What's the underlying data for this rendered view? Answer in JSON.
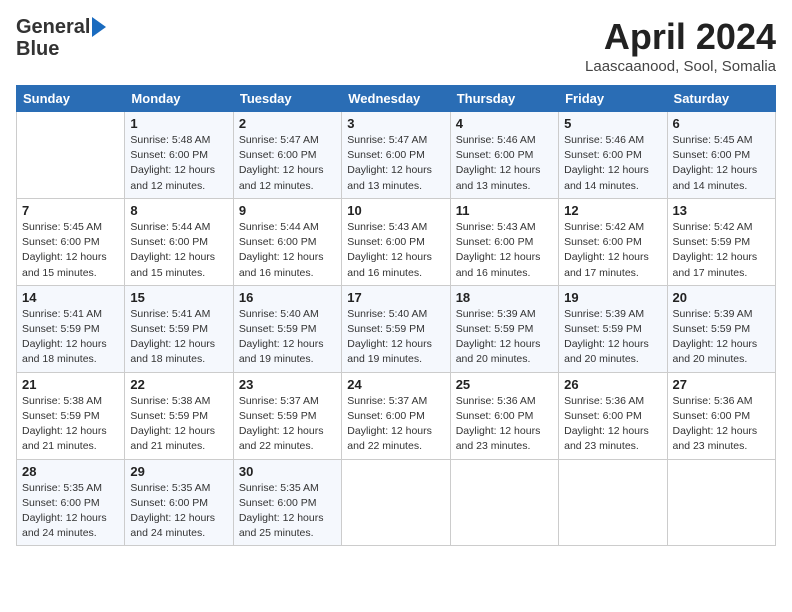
{
  "logo": {
    "line1": "General",
    "line2": "Blue"
  },
  "title": "April 2024",
  "location": "Laascaanood, Sool, Somalia",
  "days_header": [
    "Sunday",
    "Monday",
    "Tuesday",
    "Wednesday",
    "Thursday",
    "Friday",
    "Saturday"
  ],
  "weeks": [
    [
      {
        "num": "",
        "info": ""
      },
      {
        "num": "1",
        "info": "Sunrise: 5:48 AM\nSunset: 6:00 PM\nDaylight: 12 hours\nand 12 minutes."
      },
      {
        "num": "2",
        "info": "Sunrise: 5:47 AM\nSunset: 6:00 PM\nDaylight: 12 hours\nand 12 minutes."
      },
      {
        "num": "3",
        "info": "Sunrise: 5:47 AM\nSunset: 6:00 PM\nDaylight: 12 hours\nand 13 minutes."
      },
      {
        "num": "4",
        "info": "Sunrise: 5:46 AM\nSunset: 6:00 PM\nDaylight: 12 hours\nand 13 minutes."
      },
      {
        "num": "5",
        "info": "Sunrise: 5:46 AM\nSunset: 6:00 PM\nDaylight: 12 hours\nand 14 minutes."
      },
      {
        "num": "6",
        "info": "Sunrise: 5:45 AM\nSunset: 6:00 PM\nDaylight: 12 hours\nand 14 minutes."
      }
    ],
    [
      {
        "num": "7",
        "info": "Sunrise: 5:45 AM\nSunset: 6:00 PM\nDaylight: 12 hours\nand 15 minutes."
      },
      {
        "num": "8",
        "info": "Sunrise: 5:44 AM\nSunset: 6:00 PM\nDaylight: 12 hours\nand 15 minutes."
      },
      {
        "num": "9",
        "info": "Sunrise: 5:44 AM\nSunset: 6:00 PM\nDaylight: 12 hours\nand 16 minutes."
      },
      {
        "num": "10",
        "info": "Sunrise: 5:43 AM\nSunset: 6:00 PM\nDaylight: 12 hours\nand 16 minutes."
      },
      {
        "num": "11",
        "info": "Sunrise: 5:43 AM\nSunset: 6:00 PM\nDaylight: 12 hours\nand 16 minutes."
      },
      {
        "num": "12",
        "info": "Sunrise: 5:42 AM\nSunset: 6:00 PM\nDaylight: 12 hours\nand 17 minutes."
      },
      {
        "num": "13",
        "info": "Sunrise: 5:42 AM\nSunset: 5:59 PM\nDaylight: 12 hours\nand 17 minutes."
      }
    ],
    [
      {
        "num": "14",
        "info": "Sunrise: 5:41 AM\nSunset: 5:59 PM\nDaylight: 12 hours\nand 18 minutes."
      },
      {
        "num": "15",
        "info": "Sunrise: 5:41 AM\nSunset: 5:59 PM\nDaylight: 12 hours\nand 18 minutes."
      },
      {
        "num": "16",
        "info": "Sunrise: 5:40 AM\nSunset: 5:59 PM\nDaylight: 12 hours\nand 19 minutes."
      },
      {
        "num": "17",
        "info": "Sunrise: 5:40 AM\nSunset: 5:59 PM\nDaylight: 12 hours\nand 19 minutes."
      },
      {
        "num": "18",
        "info": "Sunrise: 5:39 AM\nSunset: 5:59 PM\nDaylight: 12 hours\nand 20 minutes."
      },
      {
        "num": "19",
        "info": "Sunrise: 5:39 AM\nSunset: 5:59 PM\nDaylight: 12 hours\nand 20 minutes."
      },
      {
        "num": "20",
        "info": "Sunrise: 5:39 AM\nSunset: 5:59 PM\nDaylight: 12 hours\nand 20 minutes."
      }
    ],
    [
      {
        "num": "21",
        "info": "Sunrise: 5:38 AM\nSunset: 5:59 PM\nDaylight: 12 hours\nand 21 minutes."
      },
      {
        "num": "22",
        "info": "Sunrise: 5:38 AM\nSunset: 5:59 PM\nDaylight: 12 hours\nand 21 minutes."
      },
      {
        "num": "23",
        "info": "Sunrise: 5:37 AM\nSunset: 5:59 PM\nDaylight: 12 hours\nand 22 minutes."
      },
      {
        "num": "24",
        "info": "Sunrise: 5:37 AM\nSunset: 6:00 PM\nDaylight: 12 hours\nand 22 minutes."
      },
      {
        "num": "25",
        "info": "Sunrise: 5:36 AM\nSunset: 6:00 PM\nDaylight: 12 hours\nand 23 minutes."
      },
      {
        "num": "26",
        "info": "Sunrise: 5:36 AM\nSunset: 6:00 PM\nDaylight: 12 hours\nand 23 minutes."
      },
      {
        "num": "27",
        "info": "Sunrise: 5:36 AM\nSunset: 6:00 PM\nDaylight: 12 hours\nand 23 minutes."
      }
    ],
    [
      {
        "num": "28",
        "info": "Sunrise: 5:35 AM\nSunset: 6:00 PM\nDaylight: 12 hours\nand 24 minutes."
      },
      {
        "num": "29",
        "info": "Sunrise: 5:35 AM\nSunset: 6:00 PM\nDaylight: 12 hours\nand 24 minutes."
      },
      {
        "num": "30",
        "info": "Sunrise: 5:35 AM\nSunset: 6:00 PM\nDaylight: 12 hours\nand 25 minutes."
      },
      {
        "num": "",
        "info": ""
      },
      {
        "num": "",
        "info": ""
      },
      {
        "num": "",
        "info": ""
      },
      {
        "num": "",
        "info": ""
      }
    ]
  ]
}
